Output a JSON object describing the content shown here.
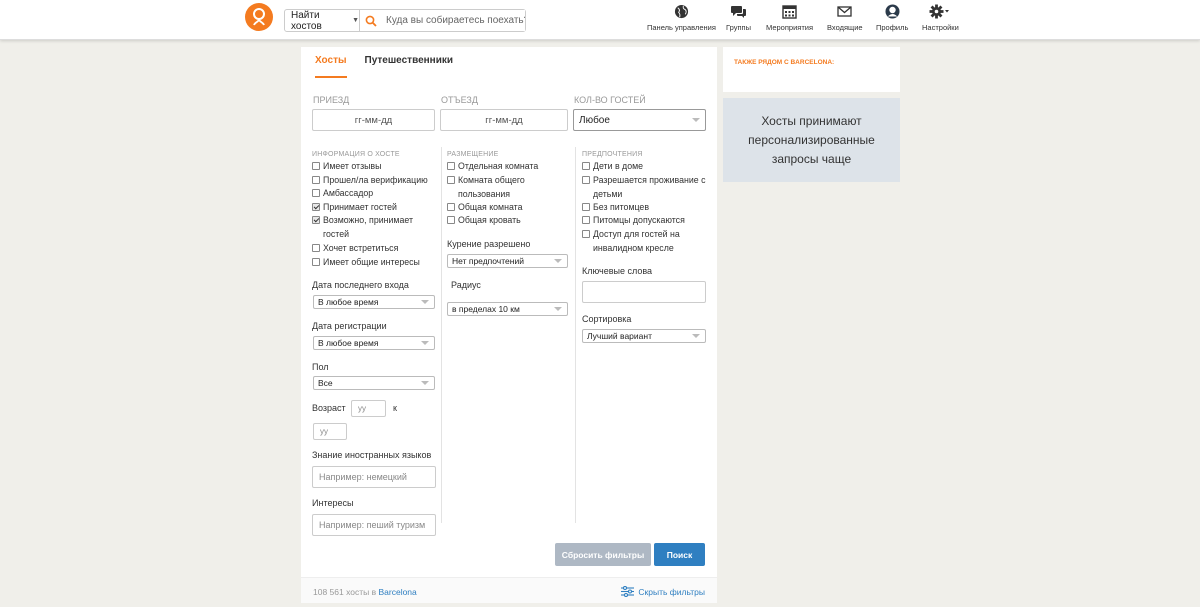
{
  "header": {
    "search_mode": "Найти хостов",
    "search_placeholder": "Куда вы собираетесь поехать?",
    "nav": [
      {
        "label": "Панель управления",
        "icon": "globe-icon"
      },
      {
        "label": "Группы",
        "icon": "chat-bubbles-icon"
      },
      {
        "label": "Мероприятия",
        "icon": "calendar-icon"
      },
      {
        "label": "Входящие",
        "icon": "envelope-icon"
      },
      {
        "label": "Профиль",
        "icon": "avatar-icon"
      },
      {
        "label": "Настройки",
        "icon": "gear-icon"
      }
    ]
  },
  "tabs": [
    "Хосты",
    "Путешественники"
  ],
  "dates": {
    "arrival_label": "ПРИЕЗД",
    "arrival_placeholder": "гг-мм-дд",
    "departure_label": "ОТЪЕЗД",
    "departure_placeholder": "гг-мм-дд",
    "guests_label": "КОЛ-ВО ГОСТЕЙ",
    "guests_value": "Любое"
  },
  "host_info": {
    "title": "ИНФОРМАЦИЯ О ХОСТЕ",
    "options": [
      {
        "label": "Имеет отзывы",
        "checked": false
      },
      {
        "label": "Прошел/ла верификацию",
        "checked": false
      },
      {
        "label": "Амбассадор",
        "checked": false
      },
      {
        "label": "Принимает гостей",
        "checked": true
      },
      {
        "label": "Возможно, принимает гостей",
        "checked": true
      },
      {
        "label": "Хочет встретиться",
        "checked": false
      },
      {
        "label": "Имеет общие интересы",
        "checked": false
      }
    ],
    "last_login_label": "Дата последнего входа",
    "last_login_value": "В любое время",
    "registration_label": "Дата регистрации",
    "registration_value": "В любое время",
    "gender_label": "Пол",
    "gender_value": "Все",
    "age_label": "Возраст",
    "age_from_placeholder": "yy",
    "age_to_word": "к",
    "age_to_placeholder": "yy",
    "languages_label": "Знание иностранных языков",
    "languages_placeholder": "Например: немецкий",
    "interests_label": "Интересы",
    "interests_placeholder": "Например: пеший туризм"
  },
  "accommodation": {
    "title": "РАЗМЕЩЕНИЕ",
    "options": [
      {
        "label": "Отдельная комната",
        "checked": false
      },
      {
        "label": "Комната общего пользования",
        "checked": false
      },
      {
        "label": "Общая комната",
        "checked": false
      },
      {
        "label": "Общая кровать",
        "checked": false
      }
    ],
    "smoking_label": "Курение разрешено",
    "smoking_value": "Нет предпочтений",
    "radius_label": "Радиус",
    "radius_value": "в пределах 10 км"
  },
  "preferences": {
    "title": "ПРЕДПОЧТЕНИЯ",
    "options": [
      {
        "label": "Дети в доме",
        "checked": false
      },
      {
        "label": "Разрешается проживание с детьми",
        "checked": false
      },
      {
        "label": "Без питомцев",
        "checked": false
      },
      {
        "label": "Питомцы допускаются",
        "checked": false
      },
      {
        "label": "Доступ для гостей на инвалидном кресле",
        "checked": false
      }
    ],
    "keywords_label": "Ключевые слова",
    "sort_label": "Сортировка",
    "sort_value": "Лучший вариант"
  },
  "actions": {
    "reset_label": "Сбросить фильтры",
    "search_label": "Поиск"
  },
  "footer": {
    "count_text": "108 561 хосты в",
    "city": "Barcelona",
    "hide_filters": "Скрыть фильтры"
  },
  "sidebar": {
    "nearby_title": "ТАКЖЕ РЯДОМ С BARCELONA:",
    "promo_text": "Хосты принимают персонализированные запросы чаще"
  },
  "colors": {
    "accent": "#f47b20",
    "primary_button": "#2f7fc1",
    "reset_button": "#aeb8c4"
  }
}
